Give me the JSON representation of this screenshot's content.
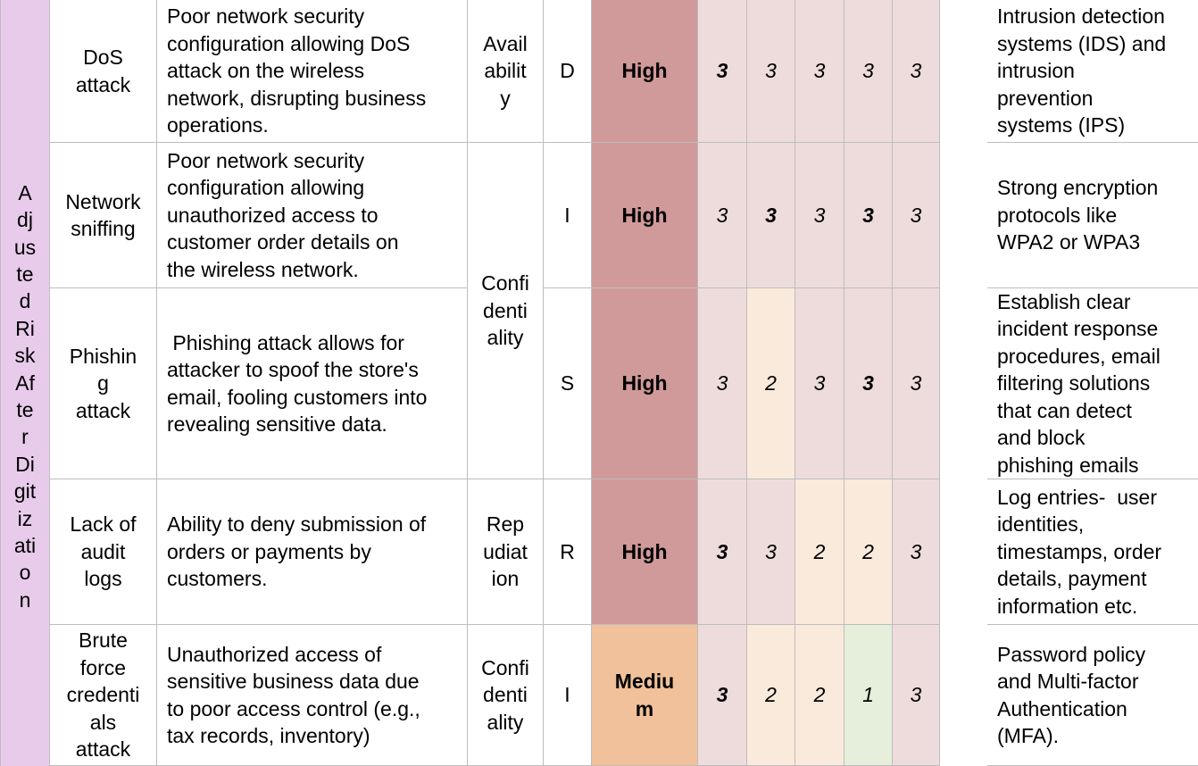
{
  "category_label": "Adjusted Risk After Digitization",
  "category_label_lines": [
    "A",
    "dj",
    "us",
    "te",
    "d",
    "Ri",
    "sk",
    "Af",
    "te",
    "r",
    "Di",
    "git",
    "iz",
    "ati",
    "o",
    "n"
  ],
  "colors": {
    "category_bg": "#e8cbeb",
    "level_high": "#d09a9a",
    "level_medium": "#f0c19a",
    "score_3": "#eedcdc",
    "score_2": "#faeadc",
    "score_1": "#e6efdc",
    "grid": "#bdbdbd"
  },
  "rows": [
    {
      "threat": "DoS attack",
      "description": "Poor network security configuration allowing DoS attack on the wireless network, disrupting business operations.",
      "property": "Availability",
      "stride": "D",
      "level": "High",
      "scores": [
        {
          "v": "3",
          "bold": true
        },
        {
          "v": "3",
          "bold": false
        },
        {
          "v": "3",
          "bold": false
        },
        {
          "v": "3",
          "bold": false
        },
        {
          "v": "3",
          "bold": false
        }
      ],
      "mitigation": "Intrusion detection systems (IDS) and intrusion prevention systems (IPS)"
    },
    {
      "threat": "Network sniffing",
      "description": "Poor network security configuration allowing unauthorized access to customer order details on the wireless network.",
      "property": "",
      "stride": "I",
      "level": "High",
      "scores": [
        {
          "v": "3",
          "bold": false
        },
        {
          "v": "3",
          "bold": true
        },
        {
          "v": "3",
          "bold": false
        },
        {
          "v": "3",
          "bold": true
        },
        {
          "v": "3",
          "bold": false
        }
      ],
      "mitigation": "Strong encryption protocols like WPA2 or WPA3"
    },
    {
      "threat": "Phishing attack",
      "description": " Phishing attack allows for attacker to spoof the store's email, fooling customers into revealing sensitive data.",
      "property": "Confidentiality",
      "stride": "S",
      "level": "High",
      "scores": [
        {
          "v": "3",
          "bold": false
        },
        {
          "v": "2",
          "bold": false
        },
        {
          "v": "3",
          "bold": false
        },
        {
          "v": "3",
          "bold": true
        },
        {
          "v": "3",
          "bold": false
        }
      ],
      "mitigation": "Establish clear incident response procedures, email filtering solutions that can detect and block phishing emails"
    },
    {
      "threat": "Lack of audit logs",
      "description": "Ability to deny submission of orders or payments by customers.",
      "property": "Repudiation",
      "stride": "R",
      "level": "High",
      "scores": [
        {
          "v": "3",
          "bold": true
        },
        {
          "v": "3",
          "bold": false
        },
        {
          "v": "2",
          "bold": false
        },
        {
          "v": "2",
          "bold": false
        },
        {
          "v": "3",
          "bold": false
        }
      ],
      "mitigation": "Log entries-  user identities, timestamps, order details, payment information etc."
    },
    {
      "threat": "Brute force credentials attack",
      "description": "Unauthorized access of sensitive business data due to poor access control (e.g., tax records, inventory)",
      "property": "Confidentiality",
      "stride": "I",
      "level": "Medium",
      "scores": [
        {
          "v": "3",
          "bold": true
        },
        {
          "v": "2",
          "bold": false
        },
        {
          "v": "2",
          "bold": false
        },
        {
          "v": "1",
          "bold": false
        },
        {
          "v": "3",
          "bold": false
        }
      ],
      "mitigation": "Password policy and Multi-factor Authentication (MFA)."
    }
  ],
  "display_lines": {
    "threat": [
      [
        "DoS",
        "attack"
      ],
      [
        "Network",
        "sniffing"
      ],
      [
        "Phishin",
        "g",
        "attack"
      ],
      [
        "Lack of",
        "audit",
        "logs"
      ],
      [
        "Brute",
        "force",
        "credenti",
        "als",
        "attack"
      ]
    ],
    "description": [
      [
        "Poor network security",
        "configuration allowing DoS",
        "attack on the wireless",
        "network, disrupting business",
        "operations."
      ],
      [
        "Poor network security",
        "configuration allowing",
        "unauthorized access to",
        "customer order details on",
        "the wireless network."
      ],
      [
        " Phishing attack allows for",
        "attacker to spoof the store's",
        "email, fooling customers into",
        "revealing sensitive data."
      ],
      [
        "Ability to deny submission of",
        "orders or payments by",
        "customers."
      ],
      [
        "Unauthorized access of",
        "sensitive business data due",
        "to poor access control (e.g.,",
        "tax records, inventory)"
      ]
    ],
    "property_cells": [
      [
        "Avail",
        "abilit",
        "y"
      ],
      [
        "Confi",
        "denti",
        "ality"
      ],
      [
        "Rep",
        "udiat",
        "ion"
      ],
      [
        "Confi",
        "denti",
        "ality"
      ]
    ],
    "level": [
      [
        "High"
      ],
      [
        "High"
      ],
      [
        "High"
      ],
      [
        "High"
      ],
      [
        "Mediu",
        "m"
      ]
    ],
    "mitigation": [
      [
        "Intrusion detection",
        "systems (IDS) and",
        "intrusion",
        "prevention",
        "systems (IPS)"
      ],
      [
        "Strong encryption",
        "protocols like",
        "WPA2 or WPA3"
      ],
      [
        "Establish clear",
        "incident response",
        "procedures, email",
        "filtering solutions",
        "that can detect",
        "and block",
        "phishing emails"
      ],
      [
        "Log entries-  user",
        "identities,",
        "timestamps, order",
        "details, payment",
        "information etc."
      ],
      [
        "Password policy",
        "and Multi-factor",
        "Authentication",
        "(MFA)."
      ]
    ]
  }
}
